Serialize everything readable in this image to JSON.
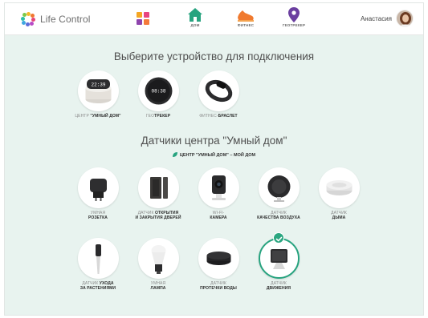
{
  "app": {
    "name": "Life Control",
    "colors": {
      "accent": "#27a37f",
      "background": "#e8f3ef",
      "header": "#ffffff"
    }
  },
  "nav": {
    "items": [
      {
        "icon": "dashboard-icon",
        "label": ""
      },
      {
        "icon": "home-icon",
        "label": "ДОМ"
      },
      {
        "icon": "sneaker-icon",
        "label": "ФИТНЕС"
      },
      {
        "icon": "location-pin-icon",
        "label": "ГЕОТРЕКЕР"
      }
    ]
  },
  "user": {
    "name": "Анастасия",
    "avatar_icon": "user-avatar"
  },
  "main": {
    "title": "Выберите устройство для подключения",
    "device_types": [
      {
        "label_light": "ЦЕНТР",
        "label_bold": "\"УМНЫЙ ДОМ\"",
        "icon": "smart-home-hub"
      },
      {
        "label_light": "ГЕО",
        "label_bold": "ТРЕКЕР",
        "icon": "geotracker",
        "screen_text": "08:38"
      },
      {
        "label_light": "ФИТНЕС-",
        "label_bold": "БРАСЛЕТ",
        "icon": "fitness-band"
      }
    ],
    "hub_screen_text": "22:39",
    "sensors_title": "Датчики центра \"Умный дом\"",
    "hub_link": "ЦЕНТР \"УМНЫЙ ДОМ\" – МОЙ ДОМ",
    "sensors": [
      {
        "light": "УМНАЯ",
        "bold1": "РОЗЕТКА",
        "bold2": "",
        "icon": "smart-plug",
        "selected": false
      },
      {
        "light": "ДАТЧИК",
        "bold1": "ОТКРЫТИЯ",
        "bold2": "И ЗАКРЫТИЯ ДВЕРЕЙ",
        "icon": "door-sensor",
        "selected": false
      },
      {
        "light": "WI-FI-",
        "bold1": "КАМЕРА",
        "bold2": "",
        "icon": "wifi-camera",
        "selected": false
      },
      {
        "light": "ДАТЧИК",
        "bold1": "КАЧЕСТВА ВОЗДУХА",
        "bold2": "",
        "icon": "air-quality-sensor",
        "selected": false
      },
      {
        "light": "ДАТЧИК",
        "bold1": "ДЫМА",
        "bold2": "",
        "icon": "smoke-detector",
        "selected": false
      },
      {
        "light": "ДАТЧИК",
        "bold1": "УХОДА",
        "bold2": "ЗА РАСТЕНИЯМИ",
        "icon": "plant-sensor",
        "selected": false
      },
      {
        "light": "УМНАЯ",
        "bold1": "ЛАМПА",
        "bold2": "",
        "icon": "smart-bulb",
        "selected": false
      },
      {
        "light": "ДАТЧИК",
        "bold1": "ПРОТЕЧКИ ВОДЫ",
        "bold2": "",
        "icon": "water-leak-sensor",
        "selected": false
      },
      {
        "light": "ДАТЧИК",
        "bold1": "ДВИЖЕНИЯ",
        "bold2": "",
        "icon": "motion-sensor",
        "selected": true
      }
    ]
  }
}
